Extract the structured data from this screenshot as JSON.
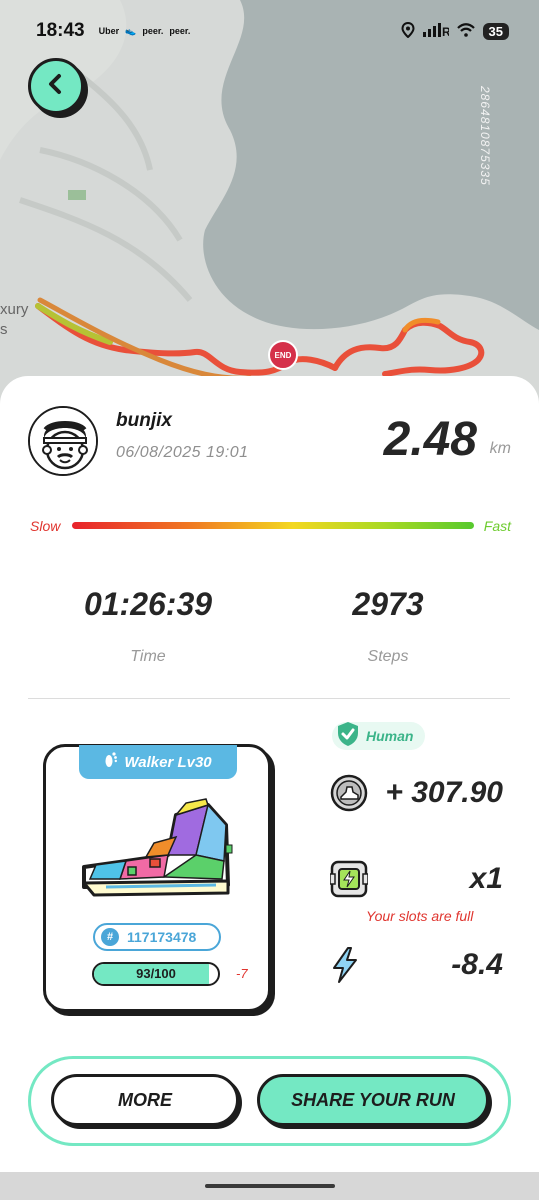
{
  "status_bar": {
    "time": "18:43",
    "apps": [
      "Uber",
      "peer.",
      "peer."
    ],
    "battery": "35",
    "icons": [
      "location-icon",
      "signal-icon",
      "wifi-icon",
      "battery-icon"
    ]
  },
  "map": {
    "route_id": "2864810875335",
    "end_label": "END",
    "place_fragment": "xury\ns"
  },
  "run": {
    "username": "bunjix",
    "datetime": "06/08/2025 19:01",
    "distance": "2.48",
    "distance_unit": "km",
    "speed_slow_label": "Slow",
    "speed_fast_label": "Fast",
    "time_value": "01:26:39",
    "time_label": "Time",
    "steps_value": "2973",
    "steps_label": "Steps"
  },
  "shoe": {
    "tier": "Walker Lv30",
    "id": "117173478",
    "durability_text": "93/100",
    "durability_current": 93,
    "durability_max": 100,
    "durability_delta": "-7"
  },
  "rewards": {
    "human_label": "Human",
    "earned": "+ 307.90",
    "slots": "x1",
    "slots_message": "Your slots are full",
    "energy": "-8.4"
  },
  "actions": {
    "more_label": "MORE",
    "share_label": "SHARE YOUR RUN"
  },
  "colors": {
    "accent": "#74e8c3",
    "shoe_blue": "#5bb8e3",
    "negative": "#e0352f",
    "fast_green": "#6dcc2e"
  }
}
